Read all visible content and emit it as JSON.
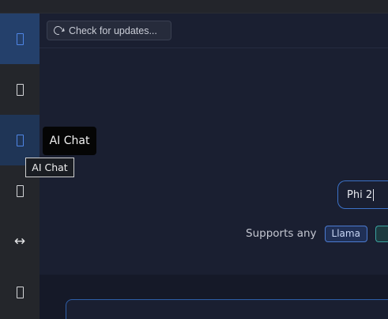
{
  "sidebar": {
    "items": [
      {
        "name": "sidebar-item-1",
        "icon": "app-icon",
        "state": "active"
      },
      {
        "name": "sidebar-item-2",
        "icon": "app-icon",
        "state": "normal"
      },
      {
        "name": "sidebar-item-ai-chat",
        "icon": "app-icon",
        "state": "hover",
        "tooltip": "AI Chat"
      },
      {
        "name": "sidebar-item-4",
        "icon": "app-icon",
        "state": "normal"
      },
      {
        "name": "sidebar-item-5",
        "icon": "left-right-arrow-icon",
        "glyph": "↔",
        "state": "normal"
      },
      {
        "name": "sidebar-item-6",
        "icon": "app-icon",
        "state": "normal"
      }
    ]
  },
  "header": {
    "check_updates_label": "Check for updates...",
    "check_updates_icon": "refresh-icon"
  },
  "hero": {
    "model_input_value": "Phi 2",
    "supports_text": "Supports any",
    "tags": [
      "Llama",
      ""
    ]
  },
  "tooltips": {
    "hover_label": "AI Chat",
    "native_title": "AI Chat"
  },
  "colors": {
    "accent": "#3c72c7",
    "active_sidebar": "#24406b",
    "background": "#1a1f31"
  }
}
